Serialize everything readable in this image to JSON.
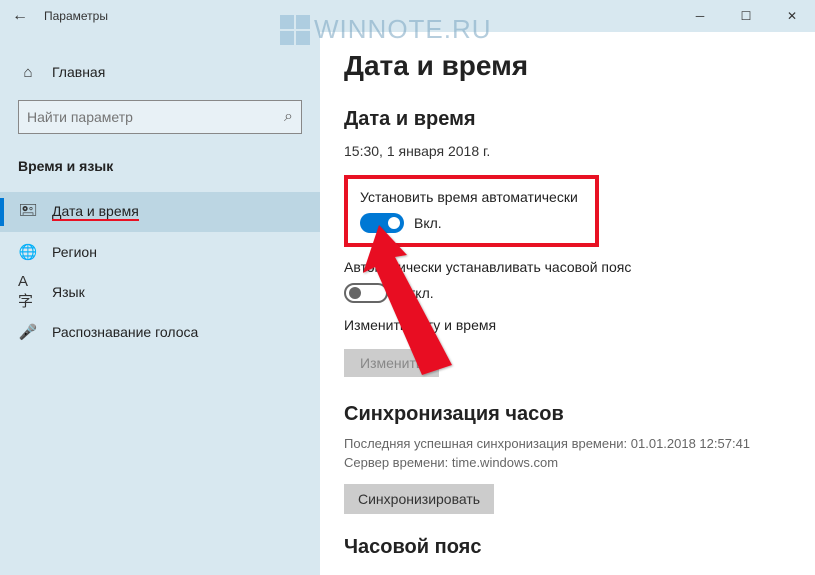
{
  "window": {
    "title": "Параметры"
  },
  "watermark": "WINNOTE.RU",
  "sidebar": {
    "home": "Главная",
    "search_placeholder": "Найти параметр",
    "category": "Время и язык",
    "items": [
      {
        "label": "Дата и время"
      },
      {
        "label": "Регион"
      },
      {
        "label": "Язык"
      },
      {
        "label": "Распознавание голоса"
      }
    ]
  },
  "main": {
    "heading": "Дата и время",
    "subheading": "Дата и время",
    "datetime": "15:30, 1 января 2018 г.",
    "auto_time_label": "Установить время автоматически",
    "auto_time_state": "Вкл.",
    "auto_tz_label": "Автоматически устанавливать часовой пояс",
    "auto_tz_state": "Откл.",
    "change_label": "Изменить дату и время",
    "change_button": "Изменить",
    "sync_heading": "Синхронизация часов",
    "sync_last": "Последняя успешная синхронизация времени:  01.01.2018  12:57:41",
    "sync_server": "Сервер времени: time.windows.com",
    "sync_button": "Синхронизировать",
    "tz_heading": "Часовой пояс"
  }
}
